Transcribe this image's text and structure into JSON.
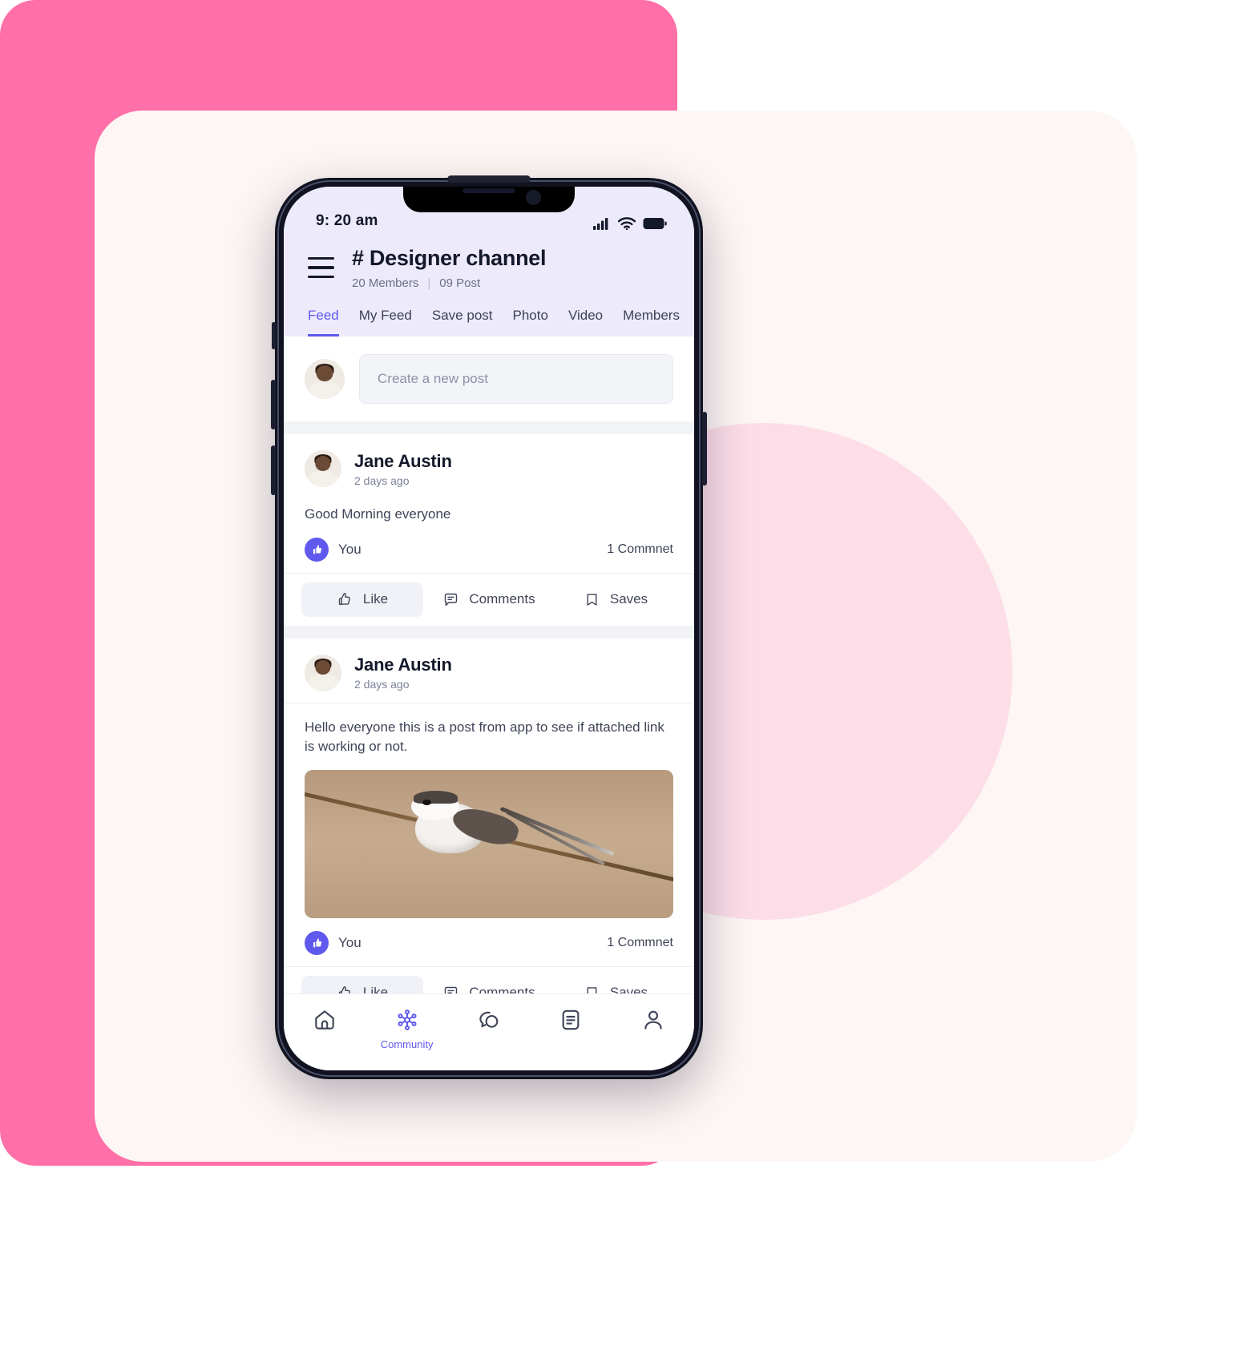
{
  "status_bar": {
    "time": "9: 20 am",
    "icons": [
      "cellular-signal-icon",
      "wifi-icon",
      "battery-icon"
    ]
  },
  "header": {
    "menu_icon": "hamburger-menu-icon",
    "title": "# Designer channel",
    "members": "20 Members",
    "separator": "|",
    "posts": "09 Post"
  },
  "tabs": [
    {
      "label": "Feed",
      "active": true
    },
    {
      "label": "My Feed",
      "active": false
    },
    {
      "label": "Save post",
      "active": false
    },
    {
      "label": "Photo",
      "active": false
    },
    {
      "label": "Video",
      "active": false
    },
    {
      "label": "Members",
      "active": false
    }
  ],
  "composer": {
    "placeholder": "Create a new post",
    "avatar": "user-avatar"
  },
  "posts": [
    {
      "author": "Jane Austin",
      "time": "2 days ago",
      "text": "Good Morning everyone",
      "has_image": false,
      "likers": "You",
      "comments": "1 Commnet",
      "actions": [
        {
          "label": "Like",
          "icon": "thumbs-up-icon",
          "active": true
        },
        {
          "label": "Comments",
          "icon": "comment-bubble-icon",
          "active": false
        },
        {
          "label": "Saves",
          "icon": "bookmark-icon",
          "active": false
        }
      ]
    },
    {
      "author": "Jane Austin",
      "time": "2 days ago",
      "text": "Hello everyone   this is a post from app to see if attached link is working or not.",
      "has_image": true,
      "image_alt": "long-tailed-tit-bird-on-branch",
      "likers": "You",
      "comments": "1 Commnet",
      "actions": [
        {
          "label": "Like",
          "icon": "thumbs-up-icon",
          "active": true
        },
        {
          "label": "Comments",
          "icon": "comment-bubble-icon",
          "active": false
        },
        {
          "label": "Saves",
          "icon": "bookmark-icon",
          "active": false
        }
      ]
    }
  ],
  "bottom_nav": [
    {
      "icon": "home-icon",
      "label": "",
      "active": false
    },
    {
      "icon": "community-hub-icon",
      "label": "Community",
      "active": true
    },
    {
      "icon": "chat-bubbles-icon",
      "label": "",
      "active": false
    },
    {
      "icon": "document-icon",
      "label": "",
      "active": false
    },
    {
      "icon": "profile-person-icon",
      "label": "",
      "active": false
    }
  ],
  "colors": {
    "background_pink": "#FF6FA8",
    "card_cream": "#FDF6F4",
    "circle_pink": "#FCDDE8",
    "accent": "#6059EE",
    "header_bg": "#EDEBFB",
    "text_dark": "#14182b"
  }
}
